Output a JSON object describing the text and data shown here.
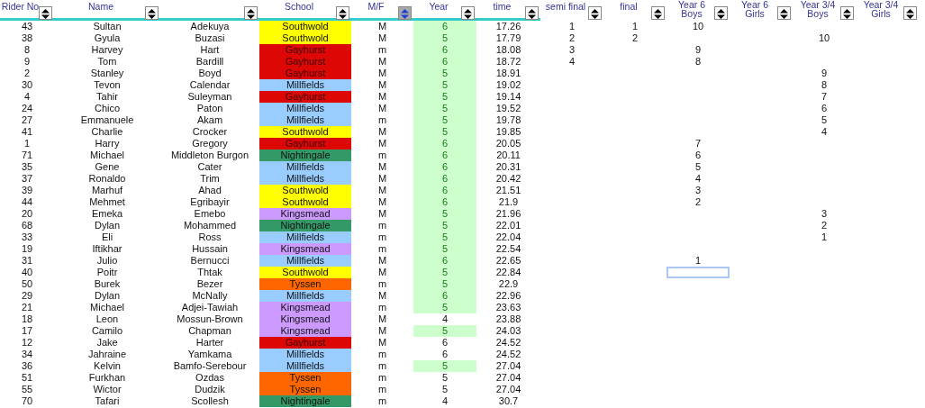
{
  "columns": [
    {
      "label": "Rider No",
      "filter_active": false
    },
    {
      "label": "Name",
      "filter_active": false
    },
    {
      "filter_active": false
    },
    {
      "label": "School",
      "filter_active": false
    },
    {
      "label": "M/F",
      "filter_active": true
    },
    {
      "label": "Year",
      "filter_active": false
    },
    {
      "label": "time",
      "filter_active": false
    },
    {
      "label": "semi final",
      "filter_active": false
    },
    {
      "label": "final",
      "filter_active": false
    },
    {
      "label": "Year 6 Boys",
      "filter_active": false
    },
    {
      "label": "Year 6 Girls",
      "filter_active": false
    },
    {
      "label": "Year 3/4 Boys",
      "filter_active": false
    },
    {
      "label": "Year 3/4 Girls",
      "filter_active": false
    }
  ],
  "rows": [
    {
      "rider_no": "43",
      "first_name": "Sultan",
      "surname": "Adekuya",
      "school": "Southwold",
      "color": "#ffff00",
      "mf": "M",
      "year": "6",
      "highlighted": true,
      "time": "17.26",
      "semi_final": "1",
      "final": "1",
      "year6_boys": "10",
      "selected": false
    },
    {
      "rider_no": "38",
      "first_name": "Gyula",
      "surname": "Buzasi",
      "school": "Southwold",
      "color": "#ffff00",
      "mf": "M",
      "year": "5",
      "highlighted": true,
      "time": "17.79",
      "semi_final": "2",
      "final": "2",
      "year34_boys": "10",
      "selected": false
    },
    {
      "rider_no": "8",
      "first_name": "Harvey",
      "surname": "Hart",
      "school": "Gayhurst",
      "color": "#dd0806",
      "mf": "m",
      "year": "6",
      "highlighted": true,
      "time": "18.08",
      "semi_final": "3",
      "year6_boys": "9",
      "selected": false
    },
    {
      "rider_no": "9",
      "first_name": "Tom",
      "surname": "Bardill",
      "school": "Gayhurst",
      "color": "#dd0806",
      "mf": "M",
      "year": "6",
      "highlighted": true,
      "time": "18.72",
      "semi_final": "4",
      "year6_boys": "8",
      "selected": false
    },
    {
      "rider_no": "2",
      "first_name": "Stanley",
      "surname": "Boyd",
      "school": "Gayhurst",
      "color": "#dd0806",
      "mf": "M",
      "year": "5",
      "highlighted": true,
      "time": "18.91",
      "year34_boys": "9",
      "selected": false
    },
    {
      "rider_no": "30",
      "first_name": "Tevon",
      "surname": "Calendar",
      "school": "Millfields",
      "color": "#99ccff",
      "mf": "M",
      "year": "5",
      "highlighted": true,
      "time": "19.02",
      "year34_boys": "8",
      "selected": false
    },
    {
      "rider_no": "4",
      "first_name": "Tahir",
      "surname": "Suleyman",
      "school": "Gayhurst",
      "color": "#dd0806",
      "mf": "M",
      "year": "5",
      "highlighted": true,
      "time": "19.14",
      "year34_boys": "7",
      "selected": false
    },
    {
      "rider_no": "24",
      "first_name": "Chico",
      "surname": "Paton",
      "school": "Millfields",
      "color": "#99ccff",
      "mf": "M",
      "year": "5",
      "highlighted": true,
      "time": "19.52",
      "year34_boys": "6",
      "selected": false
    },
    {
      "rider_no": "27",
      "first_name": "Emmanuele",
      "surname": "Akam",
      "school": "Millfields",
      "color": "#99ccff",
      "mf": "m",
      "year": "5",
      "highlighted": true,
      "time": "19.78",
      "year34_boys": "5",
      "selected": false
    },
    {
      "rider_no": "41",
      "first_name": "Charlie",
      "surname": "Crocker",
      "school": "Southwold",
      "color": "#ffff00",
      "mf": "M",
      "year": "5",
      "highlighted": true,
      "time": "19.85",
      "year34_boys": "4",
      "selected": false
    },
    {
      "rider_no": "1",
      "first_name": "Harry",
      "surname": "Gregory",
      "school": "Gayhurst",
      "color": "#dd0806",
      "mf": "M",
      "year": "6",
      "highlighted": true,
      "time": "20.05",
      "year6_boys": "7",
      "selected": false
    },
    {
      "rider_no": "71",
      "first_name": "Michael",
      "surname": "Middleton Burgon",
      "school": "Nightingale",
      "color": "#339966",
      "mf": "m",
      "year": "6",
      "highlighted": true,
      "time": "20.11",
      "year6_boys": "6",
      "selected": false
    },
    {
      "rider_no": "35",
      "first_name": "Gene",
      "surname": "Cater",
      "school": "Millfields",
      "color": "#99ccff",
      "mf": "M",
      "year": "6",
      "highlighted": true,
      "time": "20.31",
      "year6_boys": "5",
      "selected": false
    },
    {
      "rider_no": "37",
      "first_name": "Ronaldo",
      "surname": "Trim",
      "school": "Millfields",
      "color": "#99ccff",
      "mf": "M",
      "year": "6",
      "highlighted": true,
      "time": "20.42",
      "year6_boys": "4",
      "selected": false
    },
    {
      "rider_no": "39",
      "first_name": "Marhuf",
      "surname": "Ahad",
      "school": "Southwold",
      "color": "#ffff00",
      "mf": "M",
      "year": "6",
      "highlighted": true,
      "time": "21.51",
      "year6_boys": "3",
      "selected": false
    },
    {
      "rider_no": "44",
      "first_name": "Mehmet",
      "surname": "Egribayir",
      "school": "Southwold",
      "color": "#ffff00",
      "mf": "M",
      "year": "6",
      "highlighted": true,
      "time": "21.9",
      "year6_boys": "2",
      "selected": false
    },
    {
      "rider_no": "20",
      "first_name": "Emeka",
      "surname": "Emebo",
      "school": "Kingsmead",
      "color": "#cc99ff",
      "mf": "M",
      "year": "5",
      "highlighted": true,
      "time": "21.96",
      "year34_boys": "3",
      "selected": false
    },
    {
      "rider_no": "68",
      "first_name": "Dylan",
      "surname": "Mohammed",
      "school": "Nightingale",
      "color": "#339966",
      "mf": "m",
      "year": "5",
      "highlighted": true,
      "time": "22.01",
      "year34_boys": "2",
      "selected": false
    },
    {
      "rider_no": "33",
      "first_name": "Eli",
      "surname": "Ross",
      "school": "Millfields",
      "color": "#99ccff",
      "mf": "m",
      "year": "5",
      "highlighted": true,
      "time": "22.04",
      "year34_boys": "1",
      "selected": false
    },
    {
      "rider_no": "19",
      "first_name": "Iftikhar",
      "surname": "Hussain",
      "school": "Kingsmead",
      "color": "#cc99ff",
      "mf": "m",
      "year": "5",
      "highlighted": true,
      "time": "22.54",
      "selected": false
    },
    {
      "rider_no": "31",
      "first_name": "Julio",
      "surname": "Bernucci",
      "school": "Millfields",
      "color": "#99ccff",
      "mf": "M",
      "year": "6",
      "highlighted": true,
      "time": "22.65",
      "year6_boys": "1",
      "selected": false
    },
    {
      "rider_no": "40",
      "first_name": "Poitr",
      "surname": "Thtak",
      "school": "Southwold",
      "color": "#ffff00",
      "mf": "M",
      "year": "5",
      "highlighted": true,
      "time": "22.84",
      "selected": true
    },
    {
      "rider_no": "50",
      "first_name": "Burek",
      "surname": "Bezer",
      "school": "Tyssen",
      "color": "#ff6600",
      "mf": "m",
      "year": "5",
      "highlighted": true,
      "time": "22.9",
      "selected": false
    },
    {
      "rider_no": "29",
      "first_name": "Dylan",
      "surname": "McNally",
      "school": "Millfields",
      "color": "#99ccff",
      "mf": "M",
      "year": "6",
      "highlighted": true,
      "time": "22.96",
      "selected": false
    },
    {
      "rider_no": "21",
      "first_name": "Michael",
      "surname": "Adjei-Tawiah",
      "school": "Kingsmead",
      "color": "#cc99ff",
      "mf": "m",
      "year": "5",
      "highlighted": true,
      "time": "23.63",
      "selected": false
    },
    {
      "rider_no": "18",
      "first_name": "Leon",
      "surname": "Mossun-Brown",
      "school": "Kingsmead",
      "color": "#cc99ff",
      "mf": "M",
      "year": "4",
      "highlighted": false,
      "time": "23.88",
      "selected": false
    },
    {
      "rider_no": "17",
      "first_name": "Camilo",
      "surname": "Chapman",
      "school": "Kingsmead",
      "color": "#cc99ff",
      "mf": "M",
      "year": "5",
      "highlighted": true,
      "time": "24.03",
      "selected": false
    },
    {
      "rider_no": "12",
      "first_name": "Jake",
      "surname": "Harter",
      "school": "Gayhurst",
      "color": "#dd0806",
      "mf": "M",
      "year": "6",
      "highlighted": false,
      "time": "24.52",
      "selected": false
    },
    {
      "rider_no": "34",
      "first_name": "Jahraine",
      "surname": "Yamkama",
      "school": "Millfields",
      "color": "#99ccff",
      "mf": "m",
      "year": "6",
      "highlighted": false,
      "time": "24.52",
      "selected": false
    },
    {
      "rider_no": "36",
      "first_name": "Kelvin",
      "surname": "Bamfo-Serebour",
      "school": "Millfields",
      "color": "#99ccff",
      "mf": "m",
      "year": "5",
      "highlighted": true,
      "time": "27.04",
      "selected": false
    },
    {
      "rider_no": "51",
      "first_name": "Furkhan",
      "surname": "Ozdas",
      "school": "Tyssen",
      "color": "#ff6600",
      "mf": "m",
      "year": "5",
      "highlighted": false,
      "time": "27.04",
      "selected": false
    },
    {
      "rider_no": "55",
      "first_name": "Wictor",
      "surname": "Dudzik",
      "school": "Tyssen",
      "color": "#ff6600",
      "mf": "m",
      "year": "5",
      "highlighted": false,
      "time": "27.04",
      "selected": false
    },
    {
      "rider_no": "70",
      "first_name": "Tafari",
      "surname": "Scollesh",
      "school": "Nightingale",
      "color": "#339966",
      "mf": "m",
      "year": "4",
      "highlighted": false,
      "time": "30.7",
      "selected": false
    }
  ]
}
